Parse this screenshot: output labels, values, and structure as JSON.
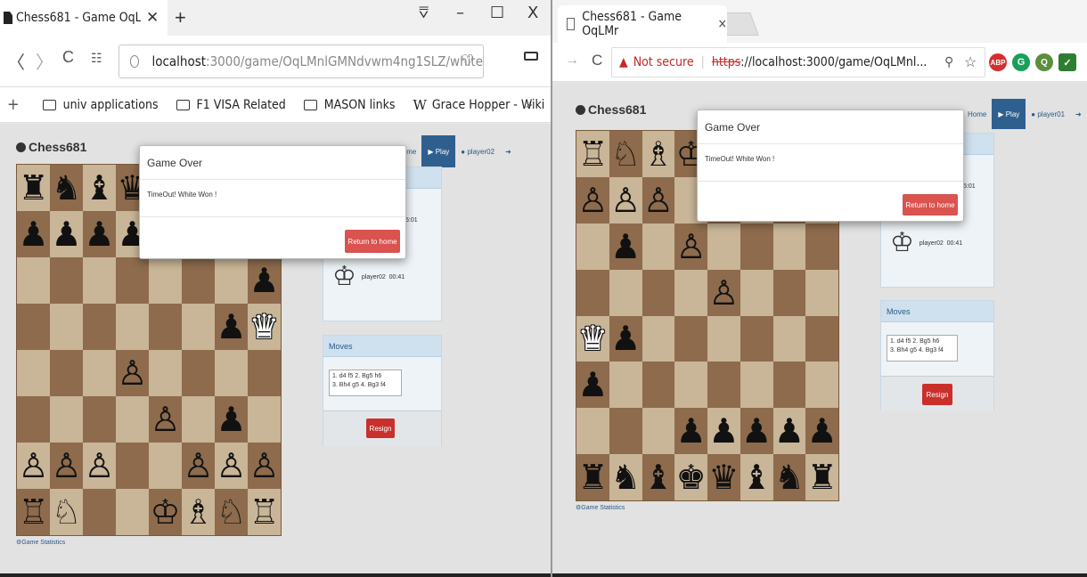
{
  "left_browser": {
    "tab_title": "Chess681 - Game OqLMnl",
    "tab_close": "✕",
    "new_tab": "+",
    "window_controls": [
      "⩢",
      "–",
      "☐",
      "X"
    ],
    "url_host": "localhost",
    "url_rest": ":3000/game/OqLMnlGMNdvwm4ng1SLZ/white",
    "bookmarks": [
      "univ applications",
      "F1 VISA Related",
      "MASON links",
      "Grace Hopper - Wiki"
    ],
    "more_bookmarks": "»"
  },
  "right_browser": {
    "tab_title": "Chess681 - Game OqLMr",
    "tab_close": "×",
    "not_secure": "Not secure",
    "https": "https",
    "url_rest": "://localhost:3000/game/OqLMnl...",
    "extensions": [
      "ABP",
      "G",
      "Q",
      "✓"
    ]
  },
  "app_left": {
    "brand": "Chess681",
    "nav_home": "Home",
    "nav_play": "Play",
    "nav_user": "player02",
    "player_name": "player02",
    "player_timer": "00:41",
    "opponent_timer": "5:01",
    "moves_header": "Moves",
    "moves_line1": "1. d4 f5 2. Bg5 h6",
    "moves_line2": "3. Bh4 g5 4. Bg3 f4",
    "resign": "Resign",
    "stats": "Game Statistics",
    "modal_title": "Game Over",
    "modal_body": "TimeOut! White Won !",
    "modal_button": "Return to home"
  },
  "app_right": {
    "brand": "Chess681",
    "nav_home": "Home",
    "nav_play": "Play",
    "nav_user": "player01",
    "player_name": "player02",
    "player_timer": "00:41",
    "opponent_timer": "5:01",
    "moves_header": "Moves",
    "moves_line1": "1. d4 f5 2. Bg5 h6",
    "moves_line2": "3. Bh4 g5 4. Bg3 f4",
    "resign": "Resign",
    "stats": "Game Statistics",
    "modal_title": "Game Over",
    "modal_body": "TimeOut! White Won !",
    "modal_button": "Return to home"
  },
  "board_left": [
    [
      "♜",
      "♞",
      "♝",
      "♛",
      "♚",
      "♝",
      "♞",
      "♜"
    ],
    [
      "♟",
      "♟",
      "♟",
      "♟",
      "♟",
      "",
      "",
      ""
    ],
    [
      "",
      "",
      "",
      "",
      "",
      "",
      "",
      "♟"
    ],
    [
      "",
      "",
      "",
      "",
      "",
      "",
      "♟",
      "♛w"
    ],
    [
      "",
      "",
      "",
      "♙",
      "",
      "",
      "",
      ""
    ],
    [
      "",
      "",
      "",
      "",
      "♙",
      "",
      "♟",
      ""
    ],
    [
      "♙",
      "♙",
      "♙",
      "",
      "",
      "♙",
      "♙",
      "♙"
    ],
    [
      "♖",
      "♘",
      "",
      "",
      "♔",
      "♗",
      "♘",
      "♖"
    ]
  ],
  "board_right": [
    [
      "♖",
      "♘",
      "♗",
      "♔",
      "",
      "",
      "",
      ""
    ],
    [
      "♙",
      "♙",
      "♙",
      "",
      "",
      "",
      "",
      ""
    ],
    [
      "",
      "♟",
      "",
      "♙",
      "",
      "",
      "",
      ""
    ],
    [
      "",
      "",
      "",
      "",
      "♙",
      "",
      "",
      ""
    ],
    [
      "♛w",
      "♟",
      "",
      "",
      "",
      "",
      "",
      ""
    ],
    [
      "♟",
      "",
      "",
      "",
      "",
      "",
      "",
      ""
    ],
    [
      "",
      "",
      "",
      "♟",
      "♟",
      "♟",
      "♟",
      "♟"
    ],
    [
      "♜",
      "♞",
      "♝",
      "♚",
      "♛",
      "♝",
      "♞",
      "♜"
    ]
  ],
  "colors": {
    "light_square": "#c9b597",
    "dark_square": "#8d6b4c",
    "play_button": "#2f5f8f",
    "resign_button": "#c9302c"
  }
}
